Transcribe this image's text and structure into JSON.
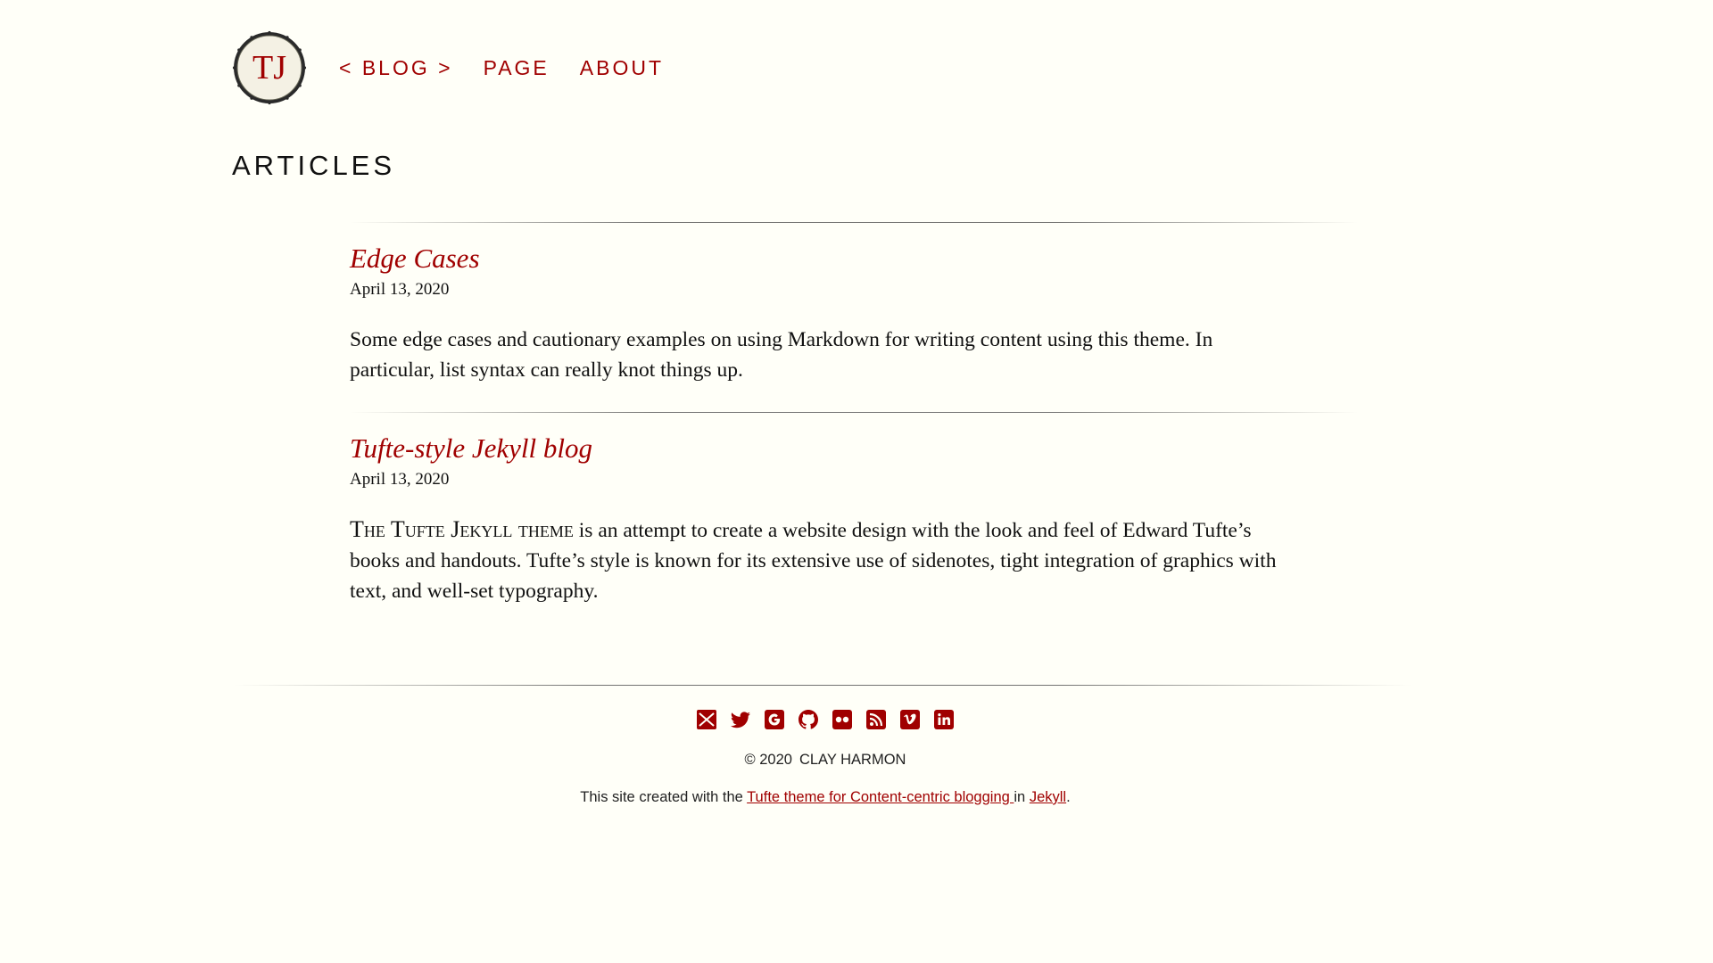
{
  "site": {
    "logo_text": "TJ"
  },
  "nav": {
    "items": [
      {
        "label": "< BLOG >"
      },
      {
        "label": "PAGE"
      },
      {
        "label": "ABOUT"
      }
    ]
  },
  "page": {
    "title": "ARTICLES"
  },
  "posts": [
    {
      "title": "Edge Cases",
      "date": "April 13, 2020",
      "excerpt": "Some edge cases and cautionary examples on using Markdown for writing content using this theme. In particular, list syntax can really knot things up."
    },
    {
      "title": "Tufte-style Jekyll blog",
      "date": "April 13, 2020",
      "excerpt_smallcaps": "The Tufte Jekyll theme",
      "excerpt_rest": " is an attempt to create a website design with the look and feel of Edward Tufte’s books and handouts. Tufte’s style is known for its extensive use of sidenotes, tight integration of graphics with text, and well-set typography."
    }
  ],
  "footer": {
    "social_icons": [
      "email-icon",
      "twitter-icon",
      "google-icon",
      "github-icon",
      "flickr-icon",
      "rss-icon",
      "vimeo-icon",
      "linkedin-icon"
    ],
    "copyright_year": "© 2020",
    "author": "CLAY HARMON",
    "credit_prefix": "This site created with the ",
    "credit_link1": "Tufte theme for Content-centric blogging ",
    "credit_mid": " in ",
    "credit_link2": "Jekyll",
    "credit_suffix": "."
  },
  "colors": {
    "background": "#fffff8",
    "accent": "#a00000",
    "text": "#111111"
  }
}
